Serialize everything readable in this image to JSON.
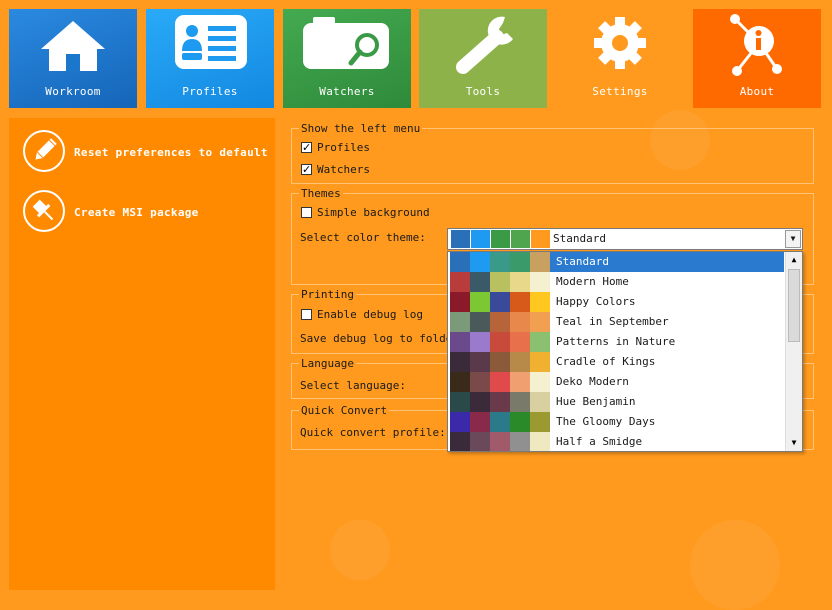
{
  "nav": {
    "tiles": [
      {
        "label": "Workroom",
        "icon": "house-icon",
        "color": "#1B77CC"
      },
      {
        "label": "Profiles",
        "icon": "profiles-icon",
        "color": "#1E9BF0"
      },
      {
        "label": "Watchers",
        "icon": "watchers-icon",
        "color": "#3A9A46"
      },
      {
        "label": "Tools",
        "icon": "wrench-icon",
        "color": "#8DB24A"
      },
      {
        "label": "Settings",
        "icon": "gear-icon",
        "color": "#FF9A1E"
      },
      {
        "label": "About",
        "icon": "about-icon",
        "color": "#FF6A00"
      }
    ],
    "active": "Settings"
  },
  "left_panel": {
    "items": [
      {
        "label": "Reset preferences to default",
        "icon": "pencil-icon"
      },
      {
        "label": "Create MSI package",
        "icon": "pin-icon"
      }
    ]
  },
  "settings": {
    "left_menu": {
      "title": "Show the left menu",
      "profiles_label": "Profiles",
      "profiles_checked": true,
      "watchers_label": "Watchers",
      "watchers_checked": true
    },
    "themes": {
      "title": "Themes",
      "simple_background_label": "Simple background",
      "simple_background_checked": false,
      "color_theme_label": "Select color theme:",
      "selected_theme": "Standard",
      "selected_colors": [
        "#2A70B8",
        "#1E9BF0",
        "#3A9A46",
        "#4FA54E",
        "#FF9A1E"
      ],
      "options": [
        {
          "name": "Standard",
          "colors": [
            "#2A70B8",
            "#1E9BF0",
            "#3A9A8A",
            "#3A9A6A",
            "#C8A060"
          ]
        },
        {
          "name": "Modern Home",
          "colors": [
            "#B83C3C",
            "#3A5A6A",
            "#B8C060",
            "#E8D88A",
            "#F5F0D0"
          ]
        },
        {
          "name": "Happy Colors",
          "colors": [
            "#8A1A2A",
            "#7CC832",
            "#3A4A9A",
            "#D85A1A",
            "#FFC820"
          ]
        },
        {
          "name": "Teal in September",
          "colors": [
            "#7A9A7A",
            "#4A5A5A",
            "#B8643A",
            "#E8884A",
            "#F0A050"
          ]
        },
        {
          "name": "Patterns in Nature",
          "colors": [
            "#6A4A8A",
            "#9A7ACA",
            "#C84A3A",
            "#E8704A",
            "#8AC070"
          ]
        },
        {
          "name": "Cradle of Kings",
          "colors": [
            "#3A2A3A",
            "#5A3A4A",
            "#8A5A3A",
            "#B88A4A",
            "#F0B030"
          ]
        },
        {
          "name": "Deko Modern",
          "colors": [
            "#3A2A1A",
            "#7A4A4A",
            "#E04A4A",
            "#F0A070",
            "#F5F0D0"
          ]
        },
        {
          "name": "Hue Benjamin",
          "colors": [
            "#2A4A4A",
            "#3A2A3A",
            "#6A3A4A",
            "#7A7A6A",
            "#D8D0A0"
          ]
        },
        {
          "name": "The Gloomy Days",
          "colors": [
            "#3A2AAA",
            "#8A2A4A",
            "#2A7A8A",
            "#2A8A2A",
            "#9A9A30"
          ]
        },
        {
          "name": "Half a Smidge",
          "colors": [
            "#3A2A3A",
            "#6A4A5A",
            "#A05A6A",
            "#909090",
            "#F0E8C0"
          ]
        }
      ]
    },
    "printing": {
      "title": "Printing",
      "debug_log_label": "Enable debug log",
      "debug_log_checked": false,
      "save_folder_label": "Save debug log to folder"
    },
    "language": {
      "title": "Language",
      "select_label": "Select language:"
    },
    "quick_convert": {
      "title": "Quick Convert",
      "profile_label": "Quick convert profile:"
    }
  }
}
